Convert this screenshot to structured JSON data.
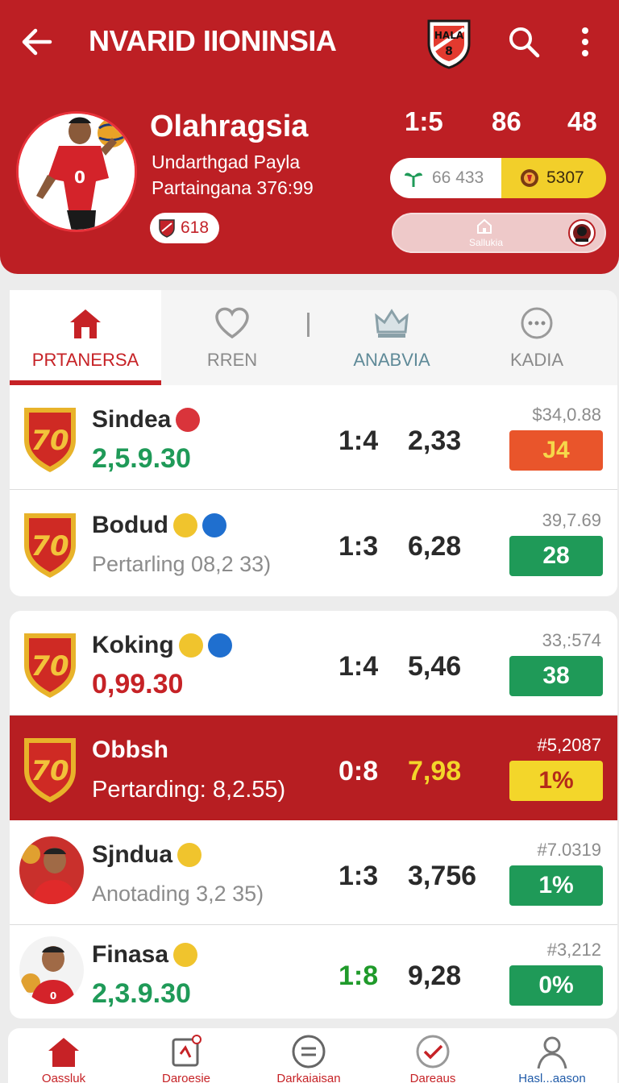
{
  "header": {
    "title": "NVARID IIONINSIA",
    "back_icon": "arrow-left-icon",
    "search_icon": "search-icon",
    "more_icon": "more-vertical-icon",
    "logo_text": "HALA DOSA 8"
  },
  "profile": {
    "name": "Olahragsia",
    "line1": "Undarthgad Payla",
    "line2": "Partaingana 376:99",
    "chip_value": "618",
    "stats": [
      "1:5",
      "86",
      "48"
    ],
    "pill_left_value": "66 433",
    "pill_right_value": "5307",
    "action_label": "Sallukia"
  },
  "tabs": [
    {
      "label": "PRTANERSA",
      "icon": "home-icon",
      "active": true
    },
    {
      "label": "RREN",
      "icon": "heart-icon",
      "active": false
    },
    {
      "label": "ANABVIA",
      "icon": "crown-icon",
      "active": false
    },
    {
      "label": "KADIA",
      "icon": "more-circle-icon",
      "active": false
    }
  ],
  "rows": [
    {
      "name": "Sindea",
      "sub": "2,5.9.30",
      "sub_style": "big-green",
      "score": "1:4",
      "odds": "2,33",
      "price": "$34,0.88",
      "badge": "J4",
      "badge_color": "orange",
      "avatar": "shield",
      "icons": [
        "red"
      ]
    },
    {
      "name": "Bodud",
      "sub": "Pertarling 08,2 33)",
      "sub_style": "small-gray",
      "score": "1:3",
      "odds": "6,28",
      "price": "39,7.69",
      "badge": "28",
      "badge_color": "green",
      "avatar": "shield",
      "icons": [
        "yellow",
        "blue"
      ]
    },
    {
      "name": "Koking",
      "sub": "0,99.30",
      "sub_style": "big-red",
      "score": "1:4",
      "odds": "5,46",
      "price": "33,:574",
      "badge": "38",
      "badge_color": "green",
      "avatar": "shield",
      "icons": [
        "yellow",
        "blue"
      ]
    },
    {
      "name": "Obbsh",
      "sub": "Pertarding: 8,2.55)",
      "sub_style": "highlight",
      "score": "0:8",
      "odds": "7,98",
      "price": "#5,2087",
      "badge": "1%",
      "badge_color": "yellow",
      "avatar": "shield",
      "icons": []
    },
    {
      "name": "Sjndua",
      "sub": "Anotading 3,2 35)",
      "sub_style": "small-gray",
      "score": "1:3",
      "odds": "3,756",
      "price": "#7.0319",
      "badge": "1%",
      "badge_color": "green",
      "avatar": "photo",
      "icons": [
        "yellow"
      ]
    },
    {
      "name": "Finasa",
      "sub": "2,3.9.30",
      "sub_style": "big-green",
      "score": "1:8",
      "odds": "9,28",
      "price": "#3,212",
      "badge": "0%",
      "badge_color": "green",
      "avatar": "photo",
      "icons": [
        "yellow"
      ]
    }
  ],
  "bottom_nav": [
    {
      "label": "Oassluk",
      "icon": "home-icon",
      "active": true
    },
    {
      "label": "Daroesie",
      "icon": "calendar-icon",
      "active": false
    },
    {
      "label": "Darkaiaisan",
      "icon": "equals-circle-icon",
      "active": false
    },
    {
      "label": "Dareaus",
      "icon": "check-circle-icon",
      "active": false
    },
    {
      "label": "Hasl...aason",
      "icon": "user-icon",
      "active": false
    }
  ],
  "colors": {
    "brand_red": "#bd1f24",
    "accent_green": "#1f9a58",
    "accent_yellow": "#f3d62a",
    "accent_orange": "#e9552b"
  }
}
